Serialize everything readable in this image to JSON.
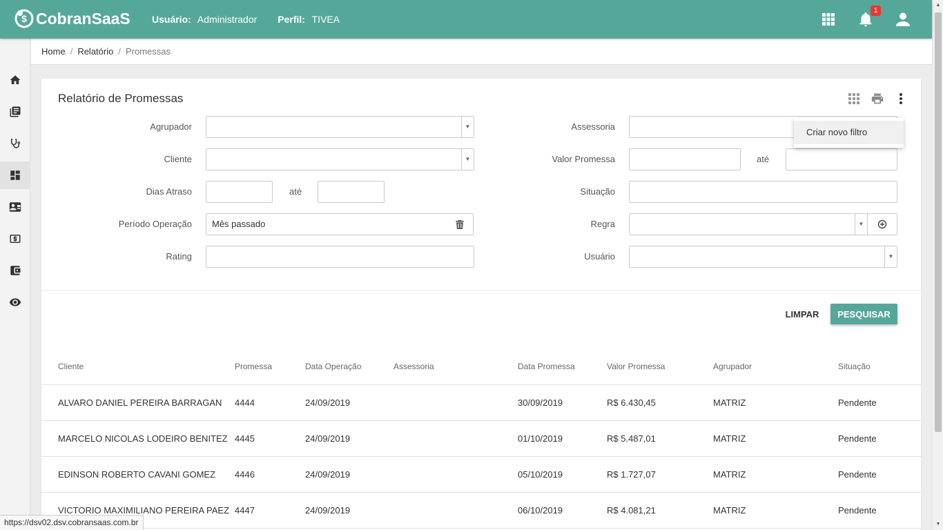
{
  "app": {
    "name": "CobranSaaS"
  },
  "header": {
    "user_label": "Usuário:",
    "user_value": "Administrador",
    "profile_label": "Perfil:",
    "profile_value": "TIVEA",
    "notification_count": "1",
    "icons": [
      "apps-grid-icon",
      "bell-icon",
      "account-icon"
    ]
  },
  "sidebar": {
    "items": [
      {
        "icon": "home-icon"
      },
      {
        "icon": "library-books-icon"
      },
      {
        "icon": "stethoscope-icon"
      },
      {
        "icon": "dashboard-icon",
        "active": true
      },
      {
        "icon": "contact-card-icon"
      },
      {
        "icon": "money-icon"
      },
      {
        "icon": "wallet-icon"
      },
      {
        "icon": "eye-icon"
      }
    ]
  },
  "breadcrumb": {
    "home": "Home",
    "sep": "/",
    "report": "Relatório",
    "current": "Promessas"
  },
  "page": {
    "title": "Relatório de Promessas"
  },
  "filters": {
    "agrupador": {
      "label": "Agrupador",
      "value": ""
    },
    "cliente": {
      "label": "Cliente",
      "value": ""
    },
    "dias_atraso": {
      "label": "Dias Atraso",
      "from": "",
      "to": ""
    },
    "periodo_operacao": {
      "label": "Período Operação",
      "value": "Mês passado"
    },
    "rating": {
      "label": "Rating",
      "value": ""
    },
    "assessoria": {
      "label": "Assessoria",
      "value": ""
    },
    "valor_promessa": {
      "label": "Valor Promessa",
      "from": "",
      "to": ""
    },
    "situacao": {
      "label": "Situação",
      "value": ""
    },
    "regra": {
      "label": "Regra",
      "value": ""
    },
    "usuario": {
      "label": "Usuário",
      "value": ""
    },
    "ate_label": "até"
  },
  "menu": {
    "create_filter": "Criar novo filtro"
  },
  "actions": {
    "clear": "LIMPAR",
    "search": "PESQUISAR"
  },
  "table": {
    "headers": [
      "Cliente",
      "Promessa",
      "Data Operação",
      "Assessoria",
      "Data Promessa",
      "Valor Promessa",
      "Agrupador",
      "Situação"
    ],
    "rows": [
      [
        "ALVARO DANIEL PEREIRA BARRAGAN",
        "4444",
        "24/09/2019",
        "",
        "30/09/2019",
        "R$ 6.430,45",
        "MATRIZ",
        "Pendente"
      ],
      [
        "MARCELO NICOLAS LODEIRO BENITEZ",
        "4445",
        "24/09/2019",
        "",
        "01/10/2019",
        "R$ 5.487,01",
        "MATRIZ",
        "Pendente"
      ],
      [
        "EDINSON ROBERTO CAVANI GOMEZ",
        "4446",
        "24/09/2019",
        "",
        "05/10/2019",
        "R$ 1.727,07",
        "MATRIZ",
        "Pendente"
      ],
      [
        "VICTORIO MAXIMILIANO PEREIRA PAEZ",
        "4447",
        "24/09/2019",
        "",
        "06/10/2019",
        "R$ 4.081,21",
        "MATRIZ",
        "Pendente"
      ]
    ]
  },
  "status_bar": {
    "url": "https://dsv02.dsv.cobransaas.com.br"
  },
  "colors": {
    "primary": "#55a899",
    "badge": "#e53935"
  }
}
